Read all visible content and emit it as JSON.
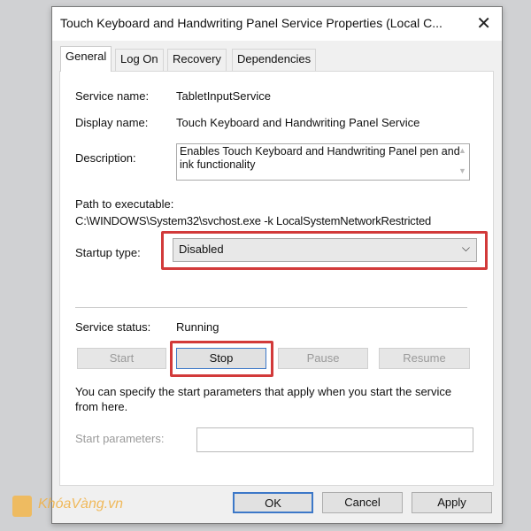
{
  "window": {
    "title": "Touch Keyboard and Handwriting Panel Service Properties (Local C...",
    "close": "✕"
  },
  "tabs": [
    {
      "label": "General"
    },
    {
      "label": "Log On"
    },
    {
      "label": "Recovery"
    },
    {
      "label": "Dependencies"
    }
  ],
  "general": {
    "service_name_label": "Service name:",
    "service_name": "TabletInputService",
    "display_name_label": "Display name:",
    "display_name": "Touch Keyboard and Handwriting Panel Service",
    "description_label": "Description:",
    "description": "Enables Touch Keyboard and Handwriting Panel pen and ink functionality",
    "path_label": "Path to executable:",
    "path": "C:\\WINDOWS\\System32\\svchost.exe -k LocalSystemNetworkRestricted",
    "startup_label": "Startup type:",
    "startup_value": "Disabled",
    "status_label": "Service status:",
    "status_value": "Running",
    "buttons": {
      "start": "Start",
      "stop": "Stop",
      "pause": "Pause",
      "resume": "Resume"
    },
    "hint": "You can specify the start parameters that apply when you start the service from here.",
    "params_label": "Start parameters:",
    "params_value": ""
  },
  "footer": {
    "ok": "OK",
    "cancel": "Cancel",
    "apply": "Apply"
  },
  "watermark": "KhóaVàng.vn",
  "colors": {
    "highlight": "#d23a3a",
    "default_button": "#3c78c8"
  }
}
